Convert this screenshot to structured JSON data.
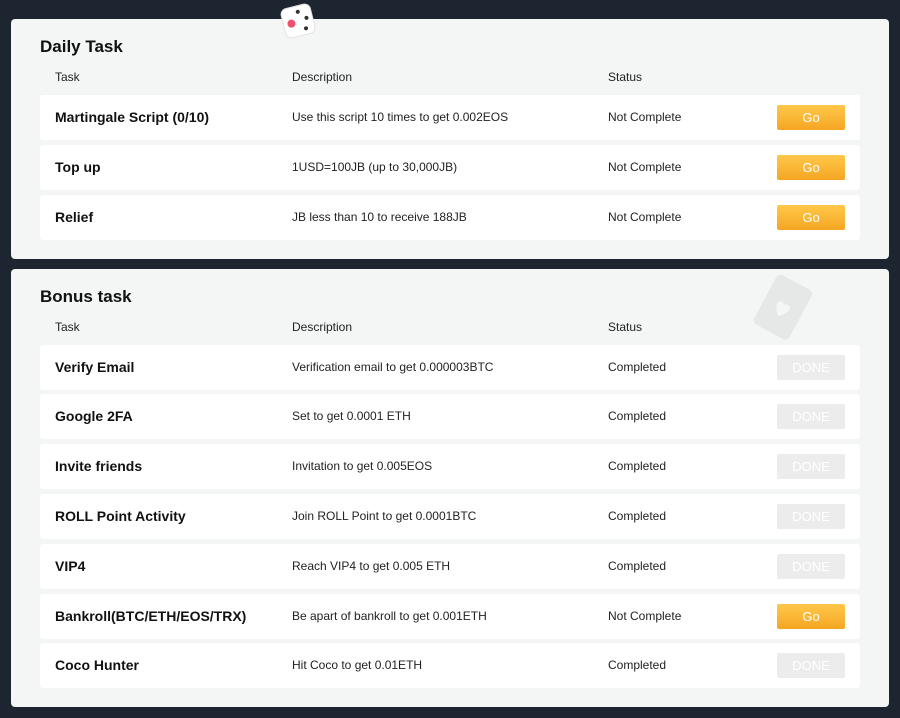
{
  "columns": {
    "task": "Task",
    "description": "Description",
    "status": "Status"
  },
  "daily": {
    "title": "Daily Task",
    "rows": [
      {
        "task": "Martingale Script (0/10)",
        "description": "Use this script 10 times to get 0.002EOS",
        "status": "Not Complete",
        "action": "Go"
      },
      {
        "task": "Top up",
        "description": "1USD=100JB (up to 30,000JB)",
        "status": "Not Complete",
        "action": "Go"
      },
      {
        "task": "Relief",
        "description": "JB less than 10 to receive 188JB",
        "status": "Not Complete",
        "action": "Go"
      }
    ]
  },
  "bonus": {
    "title": "Bonus task",
    "rows": [
      {
        "task": "Verify Email",
        "description": "Verification email to get 0.000003BTC",
        "status": "Completed",
        "action": "DONE"
      },
      {
        "task": "Google 2FA",
        "description": "Set to get 0.0001 ETH",
        "status": "Completed",
        "action": "DONE"
      },
      {
        "task": "Invite friends",
        "description": "Invitation to get 0.005EOS",
        "status": "Completed",
        "action": "DONE"
      },
      {
        "task": "ROLL Point Activity",
        "description": "Join ROLL Point to get 0.0001BTC",
        "status": "Completed",
        "action": "DONE"
      },
      {
        "task": "VIP4",
        "description": "Reach VIP4 to get 0.005 ETH",
        "status": "Completed",
        "action": "DONE"
      },
      {
        "task": "Bankroll(BTC/ETH/EOS/TRX)",
        "description": "Be apart of bankroll to get 0.001ETH",
        "status": "Not Complete",
        "action": "Go"
      },
      {
        "task": "Coco Hunter",
        "description": "Hit Coco to get 0.01ETH",
        "status": "Completed",
        "action": "DONE"
      }
    ]
  },
  "colors": {
    "background": "#1c2530",
    "panel": "#f4f5f5",
    "go_button": "#f5a623",
    "done_button": "#ececec"
  },
  "decorations": {
    "daily": "dice-icon",
    "bonus": "playing-card-heart-icon"
  }
}
